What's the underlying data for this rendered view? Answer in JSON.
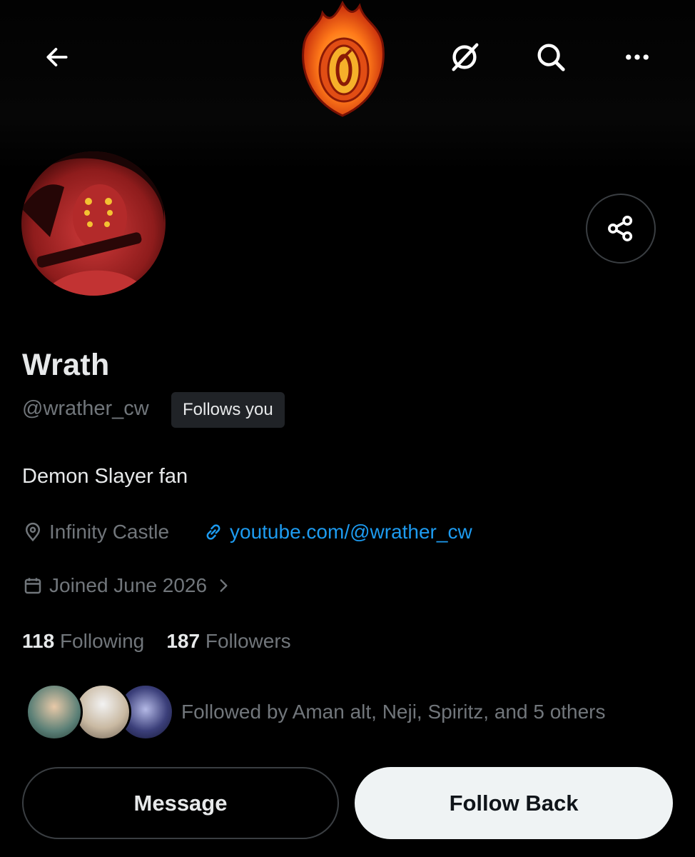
{
  "profile": {
    "display_name": "Wrath",
    "handle": "@wrather_cw",
    "follows_you_badge": "Follows you",
    "bio": "Demon Slayer fan",
    "location": "Infinity Castle",
    "website": "youtube.com/@wrather_cw",
    "joined": "Joined June 2026",
    "following_count": "118",
    "following_label": "Following",
    "followers_count": "187",
    "followers_label": "Followers",
    "followed_by": "Followed by Aman alt, Neji, Spiritz, and 5 others"
  },
  "actions": {
    "message_label": "Message",
    "follow_back_label": "Follow Back"
  },
  "icons": {
    "back": "arrow-left-icon",
    "grok": "grok-slash-icon",
    "search": "search-icon",
    "more": "more-dots-icon",
    "share": "share-icon",
    "location": "location-pin-icon",
    "link": "link-icon",
    "calendar": "calendar-icon",
    "chevron": "chevron-right-icon"
  },
  "colors": {
    "background": "#000000",
    "text_primary": "#e7e9ea",
    "text_secondary": "#71767b",
    "link": "#1d9bf0",
    "follow_button_bg": "#eff3f4",
    "border": "#3a3e42"
  }
}
